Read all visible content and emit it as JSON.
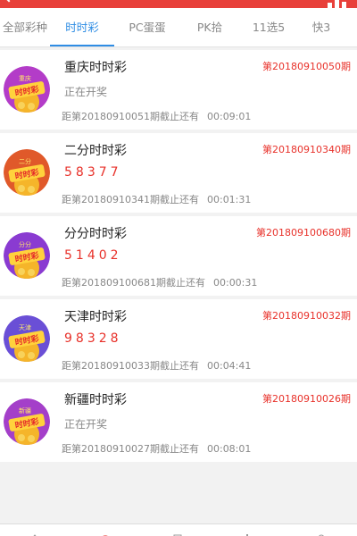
{
  "tabs": [
    {
      "label": "全部彩种"
    },
    {
      "label": "时时彩",
      "active": true
    },
    {
      "label": "PC蛋蛋"
    },
    {
      "label": "PK拾"
    },
    {
      "label": "11选5"
    },
    {
      "label": "快3"
    }
  ],
  "lotteries": [
    {
      "name": "重庆时时彩",
      "issue": "第20180910050期",
      "result": "正在开奖",
      "deadline": "距第20180910051期截止还有",
      "time": "00:09:01",
      "logo_text": "重庆",
      "logo_color": "#b33cc8"
    },
    {
      "name": "二分时时彩",
      "issue": "第20180910340期",
      "result": "58377",
      "deadline": "距第20180910341期截止还有",
      "time": "00:01:31",
      "logo_text": "二分",
      "logo_color": "#e0592a"
    },
    {
      "name": "分分时时彩",
      "issue": "第20180910068 0期",
      "result": "51402",
      "deadline": "距第20180910068 1期截止还有",
      "time": "00:00:31",
      "logo_text": "分分",
      "logo_color": "#8a3bd1"
    },
    {
      "name": "天津时时彩",
      "issue": "第20180910032期",
      "result": "98328",
      "deadline": "距第20180910033期截止还有",
      "time": "00:04:41",
      "logo_text": "天津",
      "logo_color": "#6a4fd6"
    },
    {
      "name": "新疆时时彩",
      "issue": "第20180910026期",
      "result": "正在开奖",
      "deadline": "距第20180910027期截止还有",
      "time": "00:08:01",
      "logo_text": "新疆",
      "logo_color": "#a43fc9"
    }
  ],
  "logo_caption": "时时彩",
  "colors": {
    "accent_red": "#e8312a",
    "tab_active": "#2f8de4",
    "header_red": "#e8403a"
  }
}
